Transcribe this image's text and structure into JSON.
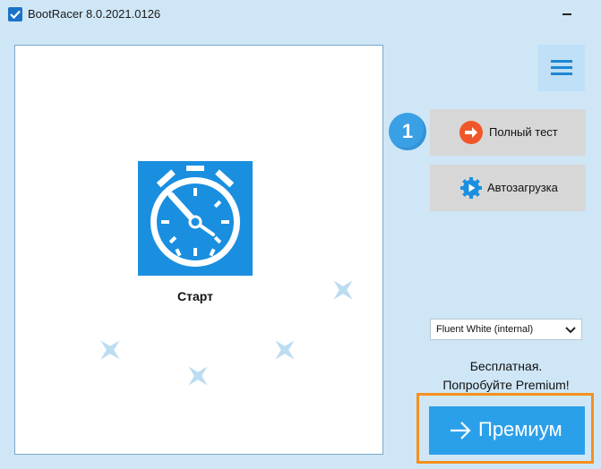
{
  "window": {
    "title": "BootRacer 8.0.2021.0126",
    "app_icon": "checkbox-check-icon",
    "minimize_icon": "minimize-icon"
  },
  "stage": {
    "start_label": "Старт",
    "start_icon": "stopwatch-icon",
    "decorations": "sparkle-icon"
  },
  "sidebar": {
    "menu_icon": "hamburger-menu-icon",
    "step_number": "1",
    "full_test": {
      "label": "Полный тест",
      "icon": "arrow-right-circle-icon"
    },
    "autoload": {
      "label": "Автозагрузка",
      "icon": "gear-play-icon"
    }
  },
  "theme": {
    "selected": "Fluent White (internal)"
  },
  "promo": {
    "line1": "Бесплатная.",
    "line2": "Попробуйте Premium!"
  },
  "premium": {
    "label": "Премиум",
    "icon": "arrow-right-icon"
  },
  "colors": {
    "window_bg": "#cfe6f6",
    "accent_blue": "#1a8fe0",
    "premium_blue": "#2ba0ea",
    "highlight_orange": "#f5901e",
    "full_test_icon": "#f0562a",
    "button_gray": "#d7d7d7"
  }
}
